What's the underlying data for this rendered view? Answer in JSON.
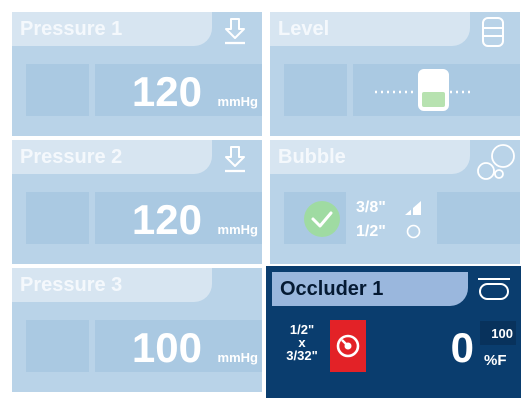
{
  "panels": {
    "pressure1": {
      "title": "Pressure 1",
      "value": "120",
      "unit": "mmHg",
      "icon": "download-arrow-icon"
    },
    "level": {
      "title": "Level",
      "icon": "level-container-icon"
    },
    "pressure2": {
      "title": "Pressure 2",
      "value": "120",
      "unit": "mmHg",
      "icon": "download-arrow-icon"
    },
    "bubble": {
      "title": "Bubble",
      "size1": "3/8\"",
      "size2": "1/2\"",
      "icon": "bubbles-icon",
      "status": "ok"
    },
    "pressure3": {
      "title": "Pressure 3",
      "value": "100",
      "unit": "mmHg"
    },
    "occluder1": {
      "title": "Occluder 1",
      "tube_top": "1/2\"",
      "tube_mid": "x",
      "tube_bottom": "3/32\"",
      "value": "0",
      "setpoint": "100",
      "unit": "%F",
      "icon": "occluder-icon"
    }
  },
  "colors": {
    "panel_light": "#b9d3e8",
    "panel_dark": "#0a3d6e",
    "header_light": "#d7e5f1",
    "header_dark": "#9ab7dd",
    "alert_red": "#e32227",
    "ok_green": "#9fdba2"
  }
}
